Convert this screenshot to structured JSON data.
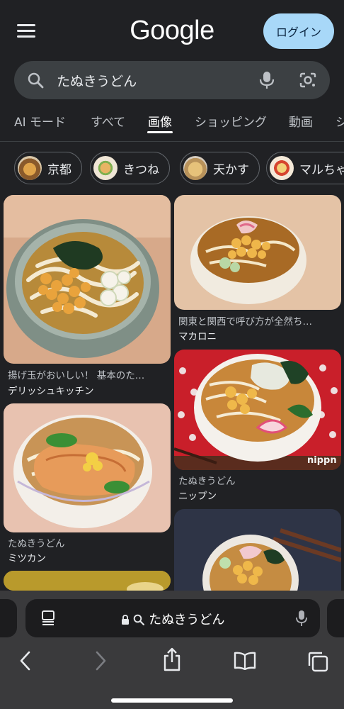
{
  "header": {
    "logo_text": "Google",
    "login_label": "ログイン"
  },
  "search": {
    "query": "たぬきうどん"
  },
  "tabs": [
    {
      "label": "AI モード"
    },
    {
      "label": "すべて"
    },
    {
      "label": "画像",
      "active": true
    },
    {
      "label": "ショッピング"
    },
    {
      "label": "動画"
    },
    {
      "label": "シ"
    }
  ],
  "chips": [
    {
      "label": "京都"
    },
    {
      "label": "きつね"
    },
    {
      "label": "天かす"
    },
    {
      "label": "マルちゃ"
    }
  ],
  "results": [
    {
      "title": "揚げ玉がおいしい！ 基本のた…",
      "source": "デリッシュキッチン"
    },
    {
      "title": "関東と関西で呼び方が全然ち…",
      "source": "マカロニ"
    },
    {
      "title": "たぬきうどん",
      "source": "ニップン",
      "watermark": "nippn"
    },
    {
      "title": "たぬきうどん",
      "source": "ミツカン"
    }
  ],
  "browser": {
    "url_text": "たぬきうどん"
  },
  "colors": {
    "background": "#202124",
    "login_bg": "#a8d8f8",
    "search_bg": "#3c4043",
    "toolbar_bg": "#3a3a3c"
  }
}
